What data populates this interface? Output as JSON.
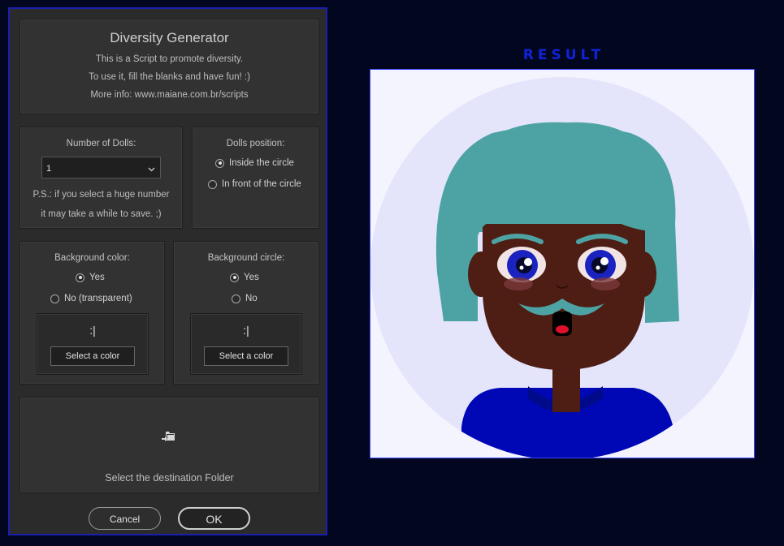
{
  "dialog": {
    "header": {
      "title": "Diversity Generator",
      "line1": "This is a Script to promote diversity.",
      "line2": "To use it, fill the blanks and have fun! :)",
      "line3": "More info: www.maiane.com.br/scripts"
    },
    "dolls": {
      "label": "Number of Dolls:",
      "selected": "1",
      "note1": "P.S.: if you select a huge number",
      "note2": "it may take a while to save. ;)"
    },
    "position": {
      "label": "Dolls position:",
      "opt_inside": "Inside the circle",
      "opt_front": "In front of the circle",
      "selected": "Inside the circle"
    },
    "bg_color": {
      "label": "Background color:",
      "opt_yes": "Yes",
      "opt_no": "No (transparent)",
      "selected": "Yes",
      "swatch_text": ":|",
      "button": "Select a color"
    },
    "bg_circle": {
      "label": "Background circle:",
      "opt_yes": "Yes",
      "opt_no": "No",
      "selected": "Yes",
      "swatch_text": ":|",
      "button": "Select a color"
    },
    "destination": {
      "icon": "folder-arrow-icon",
      "label": "Select the destination Folder"
    },
    "buttons": {
      "cancel": "Cancel",
      "ok": "OK"
    }
  },
  "result": {
    "label": "RESULT"
  },
  "colors": {
    "dialog_border": "#1a1fb0",
    "result_label": "#1122dd",
    "hair": "#4da3a3",
    "skin": "#4e1d14",
    "shirt": "#0008b5",
    "bg_circle": "#e4e4fb",
    "canvas_bg": "#f4f4ff"
  }
}
